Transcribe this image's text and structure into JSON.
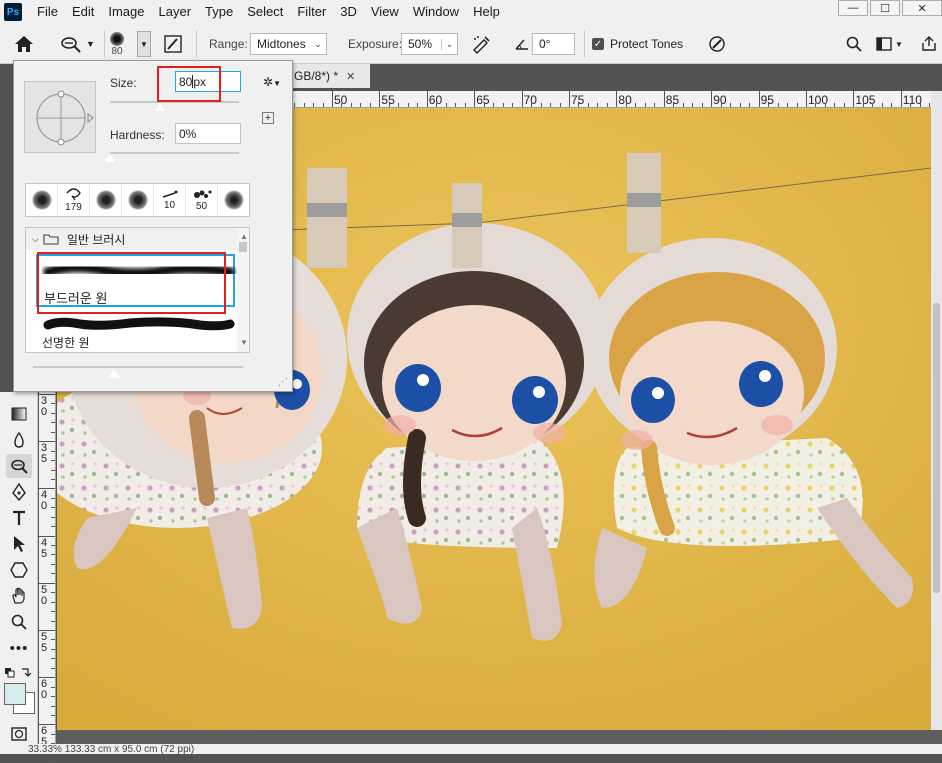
{
  "app": {
    "logo": "Ps"
  },
  "menu": {
    "items": [
      "File",
      "Edit",
      "Image",
      "Layer",
      "Type",
      "Select",
      "Filter",
      "3D",
      "View",
      "Window",
      "Help"
    ]
  },
  "window_controls": {
    "minimize": "—",
    "maximize": "☐",
    "close": "✕"
  },
  "options_bar": {
    "brush_size_preview": "80",
    "range_label": "Range:",
    "range_value": "Midtones",
    "exposure_label": "Exposure:",
    "exposure_value": "50%",
    "angle_value": "0°",
    "protect_tones_label": "Protect Tones",
    "protect_tones_checked": true
  },
  "brush_panel": {
    "size_label": "Size:",
    "size_value": "80",
    "size_unit": "px",
    "hardness_label": "Hardness:",
    "hardness_value": "0%",
    "size_slider_fraction": 0.39,
    "hardness_slider_fraction": 0.0,
    "presets": [
      {
        "label": ""
      },
      {
        "label": "179"
      },
      {
        "label": ""
      },
      {
        "label": ""
      },
      {
        "label": "10"
      },
      {
        "label": "50"
      },
      {
        "label": ""
      }
    ],
    "group_name": "일반 브러시",
    "brushes": [
      {
        "name": "부드러운 원"
      },
      {
        "name": "선명한 원"
      }
    ]
  },
  "document": {
    "tab_title": "GB/8*) *",
    "tab_close": "✕"
  },
  "rulers": {
    "horizontal": [
      "50",
      "55",
      "60",
      "65",
      "70",
      "75",
      "80",
      "85",
      "90",
      "95",
      "100",
      "105",
      "110"
    ],
    "vertical": [
      {
        "digits": [
          "3",
          "0"
        ]
      },
      {
        "digits": [
          "3",
          "5"
        ]
      },
      {
        "digits": [
          "4",
          "0"
        ]
      },
      {
        "digits": [
          "4",
          "5"
        ]
      },
      {
        "digits": [
          "5",
          "0"
        ]
      },
      {
        "digits": [
          "5",
          "5"
        ]
      },
      {
        "digits": [
          "6",
          "0"
        ]
      },
      {
        "digits": [
          "6",
          "5"
        ]
      }
    ]
  },
  "statusbar": {
    "text": "33.33%    133.33 cm x 95.0 cm (72 ppi)"
  },
  "colors": {
    "canvas_bg": "#e2b94e",
    "accent": "#1ea8df",
    "highlight": "#e0201c"
  }
}
